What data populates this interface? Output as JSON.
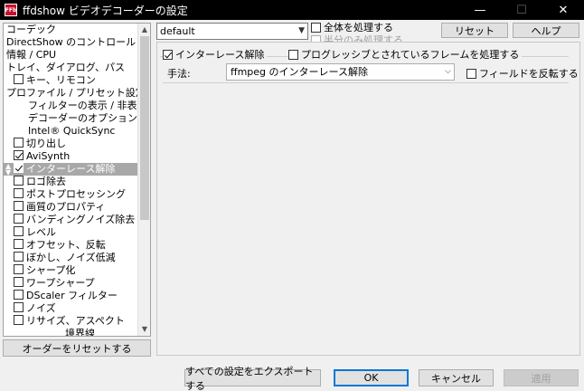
{
  "window": {
    "title": "ffdshow ビデオデコーダーの設定",
    "icon_text": "FFb",
    "controls": {
      "minimize": "—",
      "maximize": "☐",
      "close": "✕"
    }
  },
  "sidebar": {
    "items": [
      {
        "label": "コーデック",
        "checkbox": false
      },
      {
        "label": "DirectShow のコントロール",
        "checkbox": false
      },
      {
        "label": "情報 / CPU",
        "checkbox": false
      },
      {
        "label": "トレイ、ダイアログ、パス",
        "checkbox": false
      },
      {
        "label": "キー、リモコン",
        "checkbox": true,
        "checked": false
      },
      {
        "label": "プロファイル / プリセット設定",
        "checkbox": false
      },
      {
        "label": "フィルターの表示 / 非表示",
        "checkbox": false
      },
      {
        "label": "デコーダーのオプション",
        "checkbox": false
      },
      {
        "label": "Intel® QuickSync",
        "checkbox": false
      },
      {
        "label": "切り出し",
        "checkbox": true,
        "checked": false
      },
      {
        "label": "AviSynth",
        "checkbox": true,
        "checked": true
      },
      {
        "label": "インターレース解除",
        "checkbox": true,
        "checked": true,
        "selected": true
      },
      {
        "label": "ロゴ除去",
        "checkbox": true,
        "checked": false
      },
      {
        "label": "ポストプロセッシング",
        "checkbox": true,
        "checked": false
      },
      {
        "label": "画質のプロパティ",
        "checkbox": true,
        "checked": false
      },
      {
        "label": "バンディングノイズ除去",
        "checkbox": true,
        "checked": false
      },
      {
        "label": "レベル",
        "checkbox": true,
        "checked": false
      },
      {
        "label": "オフセット、反転",
        "checkbox": true,
        "checked": false
      },
      {
        "label": "ぼかし、ノイズ低減",
        "checkbox": true,
        "checked": false
      },
      {
        "label": "シャープ化",
        "checkbox": true,
        "checked": false
      },
      {
        "label": "ワープシャープ",
        "checkbox": true,
        "checked": false
      },
      {
        "label": "DScaler フィルター",
        "checkbox": true,
        "checked": false
      },
      {
        "label": "ノイズ",
        "checkbox": true,
        "checked": false
      },
      {
        "label": "リサイズ、アスペクト",
        "checkbox": true,
        "checked": false
      },
      {
        "label": "境界線",
        "checkbox": false
      }
    ],
    "reset_order_label": "オーダーをリセットする"
  },
  "top": {
    "preset_value": "default",
    "process_whole_label": "全体を処理する",
    "process_half_label": "半分のみ処理する",
    "reset_label": "リセット",
    "help_label": "ヘルプ"
  },
  "deinterlace": {
    "enabled_label": "インターレース解除",
    "progressive_label": "プログレッシブとされているフレームを処理する",
    "method_label": "手法:",
    "method_value": "ffmpeg のインターレース解除",
    "flip_fields_label": "フィールドを反転する"
  },
  "footer": {
    "export_label": "すべての設定をエクスポートする",
    "ok_label": "OK",
    "cancel_label": "キャンセル",
    "apply_label": "適用"
  }
}
